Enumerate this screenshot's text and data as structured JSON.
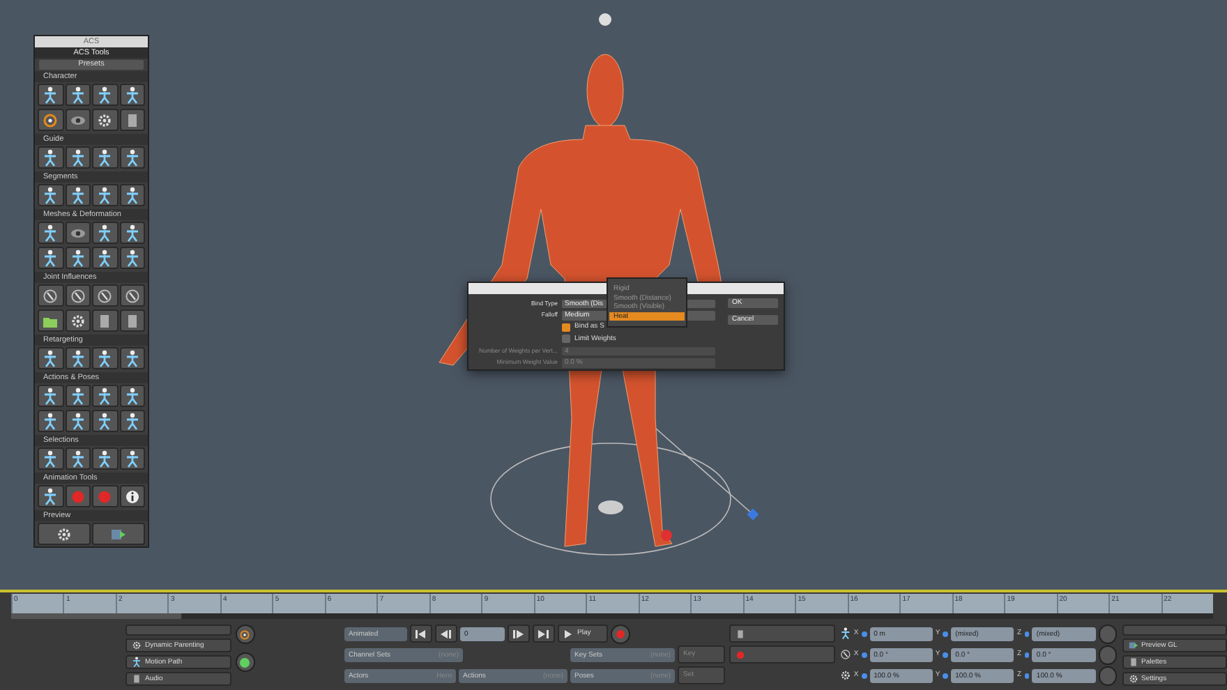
{
  "tools_panel": {
    "title": "ACS",
    "header": "ACS Tools",
    "presets": "Presets",
    "sections": [
      {
        "label": "Character",
        "rows": [
          [
            {
              "kind": "figure"
            },
            {
              "kind": "figure"
            },
            {
              "kind": "figure"
            },
            {
              "kind": "figure"
            }
          ],
          [
            {
              "kind": "target"
            },
            {
              "kind": "eye"
            },
            {
              "kind": "gear"
            },
            {
              "kind": "page"
            }
          ]
        ]
      },
      {
        "label": "Guide",
        "rows": [
          [
            {
              "kind": "figure"
            },
            {
              "kind": "figure"
            },
            {
              "kind": "figure"
            },
            {
              "kind": "figure"
            }
          ]
        ]
      },
      {
        "label": "Segments",
        "rows": [
          [
            {
              "kind": "figure"
            },
            {
              "kind": "figure"
            },
            {
              "kind": "figure"
            },
            {
              "kind": "figure"
            }
          ]
        ]
      },
      {
        "label": "Meshes & Deformation",
        "rows": [
          [
            {
              "kind": "figure"
            },
            {
              "kind": "eye"
            },
            {
              "kind": "figure"
            },
            {
              "kind": "figure"
            }
          ],
          [
            {
              "kind": "figure"
            },
            {
              "kind": "figure"
            },
            {
              "kind": "figure"
            },
            {
              "kind": "figure"
            }
          ]
        ]
      },
      {
        "label": "Joint Influences",
        "rows": [
          [
            {
              "kind": "ring"
            },
            {
              "kind": "ring"
            },
            {
              "kind": "ring"
            },
            {
              "kind": "ring"
            }
          ],
          [
            {
              "kind": "folder"
            },
            {
              "kind": "gear"
            },
            {
              "kind": "page"
            },
            {
              "kind": "page"
            }
          ]
        ]
      },
      {
        "label": "Retargeting",
        "rows": [
          [
            {
              "kind": "figure"
            },
            {
              "kind": "figure"
            },
            {
              "kind": "figure"
            },
            {
              "kind": "figure"
            }
          ]
        ]
      },
      {
        "label": "Actions & Poses",
        "rows": [
          [
            {
              "kind": "figure"
            },
            {
              "kind": "figure"
            },
            {
              "kind": "figure"
            },
            {
              "kind": "figure"
            }
          ],
          [
            {
              "kind": "figure"
            },
            {
              "kind": "figure"
            },
            {
              "kind": "figure"
            },
            {
              "kind": "figure"
            }
          ]
        ]
      },
      {
        "label": "Selections",
        "rows": [
          [
            {
              "kind": "figure"
            },
            {
              "kind": "figure"
            },
            {
              "kind": "figure"
            },
            {
              "kind": "figure"
            }
          ]
        ]
      },
      {
        "label": "Animation Tools",
        "rows": [
          [
            {
              "kind": "figure"
            },
            {
              "kind": "record"
            },
            {
              "kind": "record"
            },
            {
              "kind": "info"
            }
          ]
        ]
      },
      {
        "label": "Preview",
        "rows": [
          [
            {
              "kind": "gear"
            },
            {
              "kind": "play"
            }
          ]
        ]
      }
    ]
  },
  "dialog": {
    "fields": [
      {
        "kind": "select",
        "label": "Bind Type",
        "value": "Smooth (Dis"
      },
      {
        "kind": "select",
        "label": "Falloff",
        "value": "Medium"
      },
      {
        "kind": "checkbox",
        "label": "Bind as S",
        "checked": true
      },
      {
        "kind": "checkbox",
        "label": "Limit Weights",
        "checked": false
      },
      {
        "kind": "number",
        "label": "Number of Weights per Vert...",
        "value": "4"
      },
      {
        "kind": "number",
        "label": "Minimum Weight Value",
        "value": "0.0 %"
      }
    ],
    "buttons": [
      "OK",
      "Cancel"
    ],
    "dropdown": [
      {
        "label": "Rigid",
        "selected": false
      },
      {
        "label": "Smooth (Distance)",
        "selected": false
      },
      {
        "label": "Smooth (Visible)",
        "selected": false
      },
      {
        "label": "Heat",
        "selected": true
      }
    ]
  },
  "timeline": {
    "ticks": [
      "0",
      "1",
      "2",
      "3",
      "4",
      "5",
      "6",
      "7",
      "8",
      "9",
      "10",
      "11",
      "12",
      "13",
      "14",
      "15",
      "16",
      "17",
      "18",
      "19",
      "20",
      "21",
      "22"
    ]
  },
  "motion_panel": {
    "items": [
      "Dynamic Parenting",
      "Motion Path",
      "Audio"
    ]
  },
  "transport": {
    "mode": "Animated",
    "frame": "0",
    "play": "Play"
  },
  "sets": {
    "channel_sets": {
      "label": "Channel Sets",
      "value": "(none)"
    },
    "key_sets": {
      "label": "Key Sets",
      "value": "(none)"
    },
    "actors": {
      "label": "Actors",
      "value": "Hero"
    },
    "actions": {
      "label": "Actions",
      "value": "(none)"
    },
    "poses": {
      "label": "Poses",
      "value": "(none)"
    },
    "key_button": "Key",
    "set_button": "Set"
  },
  "transform": [
    {
      "kind": "position",
      "values": [
        {
          "axis": "X",
          "value": "0 m"
        },
        {
          "axis": "Y",
          "value": "(mixed)"
        },
        {
          "axis": "Z",
          "value": "(mixed)"
        }
      ]
    },
    {
      "kind": "rotation",
      "values": [
        {
          "axis": "X",
          "value": "0.0 °"
        },
        {
          "axis": "Y",
          "value": "0.0 °"
        },
        {
          "axis": "Z",
          "value": "0.0 °"
        }
      ]
    },
    {
      "kind": "scale",
      "values": [
        {
          "axis": "X",
          "value": "100.0 %"
        },
        {
          "axis": "Y",
          "value": "100.0 %"
        },
        {
          "axis": "Z",
          "value": "100.0 %"
        }
      ]
    }
  ],
  "view_panel": {
    "items": [
      "Preview GL",
      "Palettes",
      "Settings"
    ]
  }
}
